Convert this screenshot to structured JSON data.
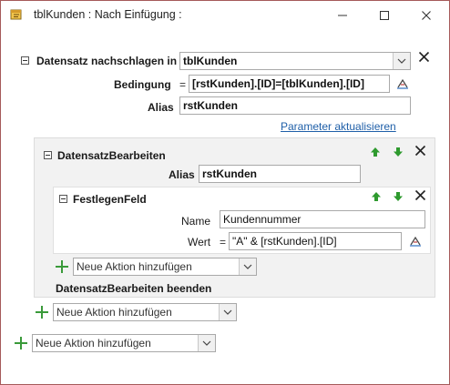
{
  "window": {
    "title": "tblKunden : Nach Einfügung :"
  },
  "colors": {
    "window_border": "#a55a5a",
    "panel_bg": "#f2f2f2",
    "link": "#1f5fa8",
    "arrow_green": "#2e9a2e",
    "plus_green": "#3a9a3a"
  },
  "lookup": {
    "header_label": "Datensatz nachschlagen in",
    "table_value": "tblKunden",
    "condition_label": "Bedingung",
    "condition_eq": "=",
    "condition_value": "[rstKunden].[ID]=[tblKunden].[ID]",
    "alias_label": "Alias",
    "alias_value": "rstKunden",
    "update_params_link": "Parameter aktualisieren"
  },
  "edit_record": {
    "header_label": "DatensatzBearbeiten",
    "alias_label": "Alias",
    "alias_value": "rstKunden",
    "end_label": "DatensatzBearbeiten beenden"
  },
  "set_field": {
    "header_label": "FestlegenFeld",
    "name_label": "Name",
    "name_value": "Kundennummer",
    "value_label": "Wert",
    "value_eq": "=",
    "value_value": "\"A\" & [rstKunden].[ID]"
  },
  "add_action": {
    "inner": "Neue Aktion hinzufügen",
    "middle": "Neue Aktion hinzufügen",
    "outer": "Neue Aktion hinzufügen"
  },
  "icons": {
    "app": "macro-icon",
    "minimize": "minimize-icon",
    "maximize": "maximize-icon",
    "close": "close-icon",
    "builder": "expression-builder-icon",
    "move_up": "arrow-up-icon",
    "move_down": "arrow-down-icon",
    "delete": "delete-x-icon",
    "add": "plus-icon"
  }
}
